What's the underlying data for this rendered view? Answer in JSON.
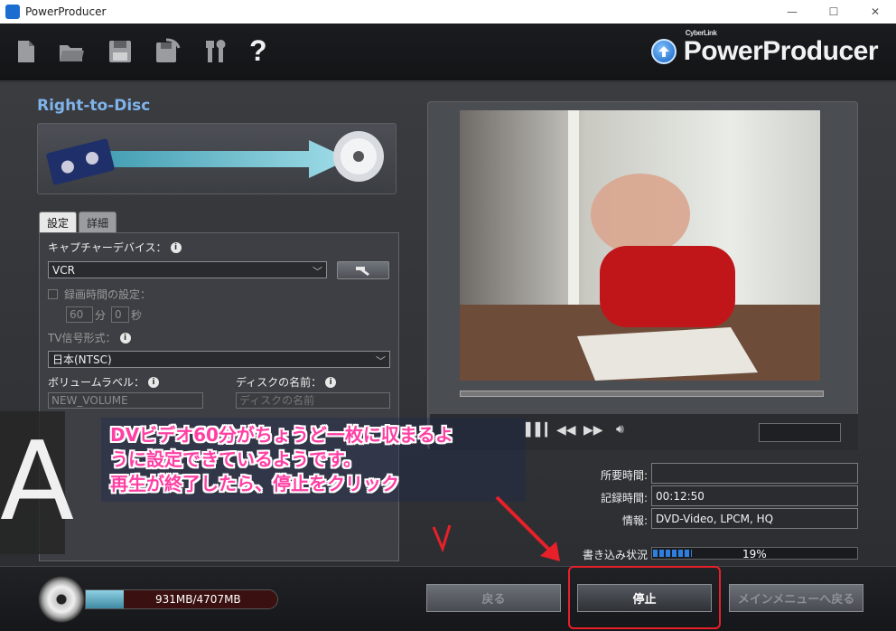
{
  "window": {
    "title": "PowerProducer",
    "minimize": "—",
    "maximize": "☐",
    "close": "✕"
  },
  "toolbar": {
    "icons": [
      "new-file-icon",
      "open-folder-icon",
      "save-icon",
      "save-as-icon",
      "tools-icon",
      "help-icon"
    ],
    "help_label": "?",
    "brand_sub": "CyberLink",
    "brand_name": "PowerProducer"
  },
  "section": {
    "title": "Right-to-Disc"
  },
  "tabs": [
    {
      "label": "設定",
      "active": true
    },
    {
      "label": "詳細",
      "active": false
    }
  ],
  "settings": {
    "capture_device_label": "キャプチャーデバイス：",
    "capture_device_value": "VCR",
    "record_time_label": "録画時間の設定：",
    "minutes_value": "60",
    "minutes_unit": "分",
    "seconds_value": "0",
    "seconds_unit": "秒",
    "tv_signal_label": "TV信号形式：",
    "tv_signal_value": "日本(NTSC)",
    "volume_label": "ボリュームラベル：",
    "volume_value": "NEW_VOLUME",
    "disc_name_label": "ディスクの名前：",
    "disc_name_placeholder": "ディスクの名前"
  },
  "info": {
    "required_time_label": "所要時間:",
    "required_time_value": "",
    "recorded_time_label": "記録時間:",
    "recorded_time_value": "00:12:50",
    "info_label": "情報:",
    "info_value": "DVD-Video, LPCM, HQ"
  },
  "write_status": {
    "label": "書き込み状況",
    "percent_text": "19%",
    "fraction": 0.19,
    "color": "#2e7fe0"
  },
  "capacity": {
    "text": "931MB/4707MB",
    "fraction": 0.198
  },
  "buttons": {
    "back": "戻る",
    "stop": "停止",
    "main_menu": "メインメニューへ戻る"
  },
  "annotation": {
    "side_letter": "A",
    "lines": [
      "DVビデオ60分がちょうど一枚に収まるよ",
      "うに設定できているようです。",
      "再生が終了したら、停止をクリック"
    ],
    "color": "#ff3fa4",
    "highlight_color": "#e8202a"
  }
}
